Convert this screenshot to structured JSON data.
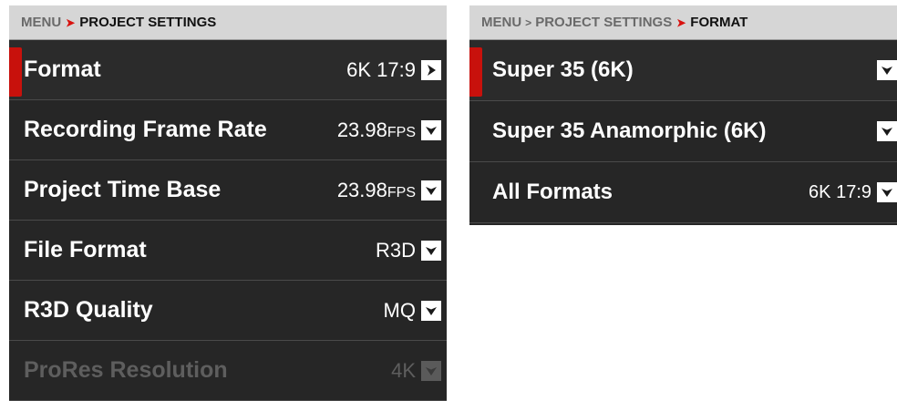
{
  "left": {
    "breadcrumb": {
      "menu": "MENU",
      "current": "PROJECT SETTINGS"
    },
    "rows": [
      {
        "label": "Format",
        "value": "6K 17:9",
        "unit": "",
        "icon": "chevron-right-icon"
      },
      {
        "label": "Recording Frame Rate",
        "value": "23.98",
        "unit": "FPS",
        "icon": "chevron-down-icon"
      },
      {
        "label": "Project Time Base",
        "value": "23.98",
        "unit": "FPS",
        "icon": "chevron-down-icon"
      },
      {
        "label": "File Format",
        "value": "R3D",
        "unit": "",
        "icon": "chevron-down-icon"
      },
      {
        "label": "R3D Quality",
        "value": "MQ",
        "unit": "",
        "icon": "chevron-down-icon"
      },
      {
        "label": "ProRes Resolution",
        "value": "4K",
        "unit": "",
        "icon": "chevron-down-icon"
      }
    ]
  },
  "right": {
    "breadcrumb": {
      "menu": "MENU",
      "middle": "PROJECT SETTINGS",
      "current": "FORMAT"
    },
    "rows": [
      {
        "label": "Super 35 (6K)",
        "value": "",
        "icon": "chevron-down-icon"
      },
      {
        "label": "Super 35 Anamorphic (6K)",
        "value": "",
        "icon": "chevron-down-icon"
      },
      {
        "label": "All Formats",
        "value": "6K 17:9",
        "icon": "chevron-down-icon"
      }
    ]
  },
  "colors": {
    "accent_red": "#c8110c",
    "panel_bg": "#262626",
    "breadcrumb_bg": "#d6d6d6",
    "disabled_text": "#5e5e5e"
  }
}
